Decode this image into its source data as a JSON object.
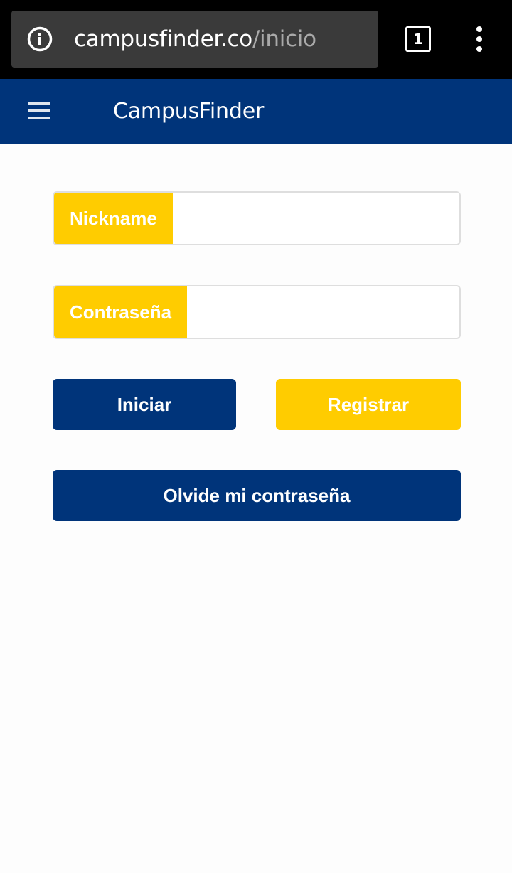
{
  "browser": {
    "url_host": "campusfinder.co",
    "url_path": "/inicio",
    "tab_count": "1",
    "info_icon": "info-icon",
    "menu_icon": "more-vert-icon"
  },
  "header": {
    "menu_icon": "hamburger-icon",
    "title": "CampusFinder",
    "background": "#00347a"
  },
  "form": {
    "nickname_label": "Nickname",
    "nickname_value": "",
    "password_label": "Contraseña",
    "password_value": "",
    "login_label": "Iniciar",
    "register_label": "Registrar",
    "forgot_label": "Olvide mi contraseña"
  },
  "colors": {
    "primary": "#00347a",
    "accent": "#ffcc00"
  }
}
